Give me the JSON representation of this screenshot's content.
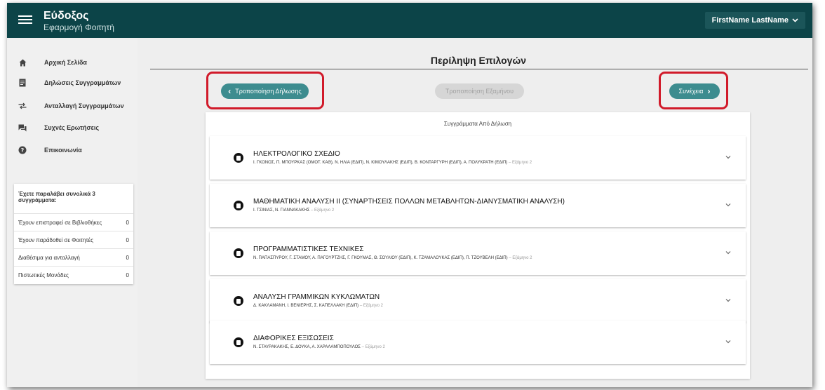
{
  "app": {
    "title": "Εύδοξος",
    "subtitle": "Εφαρμογή Φοιτητή",
    "user_name": "FirstName LastName",
    "colors": {
      "topbar": "#0c4448",
      "accent": "#3d8c8f",
      "highlight_ring": "#d11a2a"
    }
  },
  "sidebar": {
    "items": [
      {
        "label": "Αρχική Σελίδα",
        "icon": "home-icon"
      },
      {
        "label": "Δηλώσεις Συγγραμμάτων",
        "icon": "document-icon"
      },
      {
        "label": "Ανταλλαγή Συγγραμμάτων",
        "icon": "exchange-icon"
      },
      {
        "label": "Συχνές Ερωτήσεις",
        "icon": "chat-icon"
      },
      {
        "label": "Επικοινωνία",
        "icon": "help-icon"
      }
    ],
    "stats": {
      "title": "Έχετε παραλάβει συνολικά 3 συγγράμματα:",
      "rows": [
        {
          "label": "Έχουν επιστραφεί σε Βιβλιοθήκες",
          "value": "0"
        },
        {
          "label": "Έχουν παράδοθεί σε Φοιτητές",
          "value": "0"
        },
        {
          "label": "Διαθέσιμα για ανταλλαγή",
          "value": "0"
        },
        {
          "label": "Πιστωτικές Μονάδες",
          "value": "0"
        }
      ]
    }
  },
  "main": {
    "title": "Περίληψη Επιλογών",
    "buttons": {
      "modify_declaration": "Τροποποίηση Δήλωσης",
      "modify_semester": "Τροποποίηση Εξαμήνου",
      "continue": "Συνέχεια"
    },
    "list_header": "Συγγράμματα Από Δήλωση",
    "books": [
      {
        "title": "ΗΛΕΚΤΡΟΛΟΓΙΚΟ ΣΧΕΔΙΟ",
        "authors": "Ι. ΓΚΟΝΟΣ, Π. ΜΠΟΥΡΚΑΣ (ΟΜΟΤ. ΚΑΘ), Ν. ΗΛΙΑ (ΕΔΙΠ), Ν. ΚΙΜΟΥΛΑΚΗΣ (ΕΔΙΠ), Β. ΚΟΝΤΑΡΓΥΡΗ (ΕΔΙΠ), Α. ΠΟΛΥΚΡΑΤΗ (ΕΔΙΠ)",
        "semester": "Εξάμηνο 2"
      },
      {
        "title": "ΜΑΘΗΜΑΤΙΚΗ ΑΝΑΛΥΣΗ ΙΙ (ΣΥΝΑΡΤΗΣΕΙΣ ΠΟΛΛΩΝ ΜΕΤΑΒΛΗΤΩΝ-ΔΙΑΝΥΣΜΑΤΙΚΗ ΑΝΑΛΥΣΗ)",
        "authors": "Ι. ΤΣΙΝΙΑΣ, Ν. ΓΙΑΝΝΑΚΑΚΗΣ",
        "semester": "Εξάμηνο 2"
      },
      {
        "title": "ΠΡΟΓΡΑΜΜΑΤΙΣΤΙΚΕΣ ΤΕΧΝΙΚΕΣ",
        "authors": "Ν. ΠΑΠΑΣΠΥΡΟΥ, Γ. ΣΤΑΜΟΥ, Α. ΠΑΓΟΥΡΤΖΗΣ, Γ. ΓΚΟΥΜΑΣ, Θ. ΣΟΥΛΙΟΥ (ΕΔΙΠ), Κ. ΤΖΑΜΑΛΟΥΚΑΣ (ΕΔΙΠ), Π. ΤΖΟΥΒΕΛΗ (ΕΔΙΠ)",
        "semester": "Εξάμηνο 2"
      },
      {
        "title": "ΑΝΑΛΥΣΗ ΓΡΑΜΜΙΚΩΝ ΚΥΚΛΩΜΑΤΩΝ",
        "authors": "Δ. ΚΑΚΛΑΜΑΝΗ, Ι. ΒΕΝΙΕΡΗΣ, Σ. ΚΑΠΕΛΛΑΚΗ (ΕΔΙΠ)",
        "semester": "Εξάμηνο 2"
      },
      {
        "title": "ΔΙΑΦΟΡΙΚΕΣ ΕΞΙΣΩΣΕΙΣ",
        "authors": "Ν. ΣΤΑΥΡΑΚΑΚΗΣ, Ε. ΔΟΥΚΑ, Α. ΧΑΡΑΛΑΜΠΟΠΟΥΛΟΣ",
        "semester": "Εξάμηνο 2"
      }
    ]
  }
}
